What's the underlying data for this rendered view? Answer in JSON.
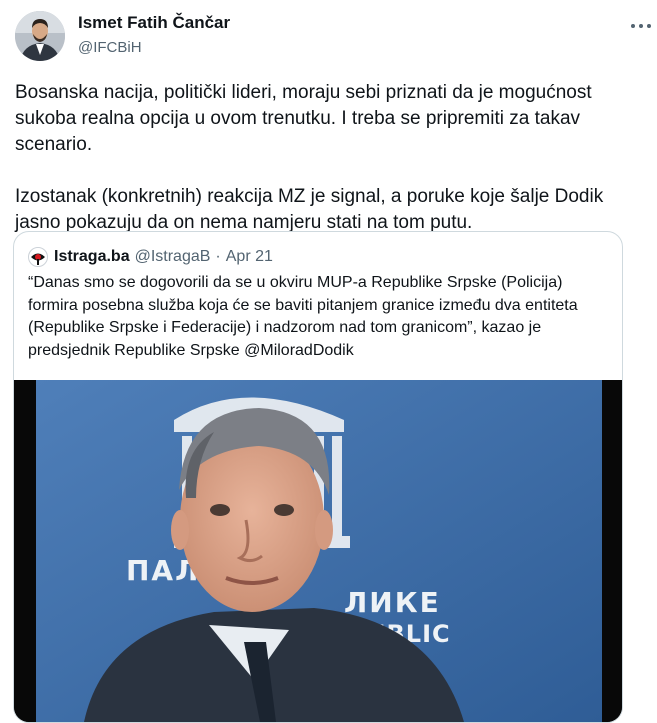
{
  "tweet": {
    "author_name": "Ismet Fatih Čančar",
    "author_handle": "@IFCBiH",
    "paragraphs": [
      "Bosanska nacija, politički lideri, moraju sebi priznati da je mogućnost sukoba realna opcija u ovom trenutku. I treba se pripremiti za takav scenario.",
      "Izostanak (konkretnih) reakcija MZ je signal, a poruke koje šalje Dodik jasno pokazuju da on nema namjeru stati na tom putu."
    ]
  },
  "quoted_tweet": {
    "author_name": "Istraga.ba",
    "author_handle": "@IstragaB",
    "separator": "·",
    "date": "Apr 21",
    "text": "“Danas smo se dogovorili da se u okviru MUP-a Republike Srpske (Policija) formira posebna služba koja će se baviti pitanjem granice između dva entiteta (Republike Srpske i Federacije) i nadzorom nad tom granicom”, kazao je predsjednik Republike Srpske @MiloradDodik",
    "media": {
      "sign_line_1": "ПАЛ           ИКЕ",
      "sign_line_2": "ЛИКЕ",
      "sign_line_3": "UBLIC"
    }
  },
  "icons": {
    "more": "more-horizontal-icon",
    "quoted_avatar": "istraga-logo-icon"
  },
  "colors": {
    "text_primary": "#0f1419",
    "text_secondary": "#536471",
    "border": "#cfd9de",
    "media_backdrop": "#3f6fa8"
  }
}
